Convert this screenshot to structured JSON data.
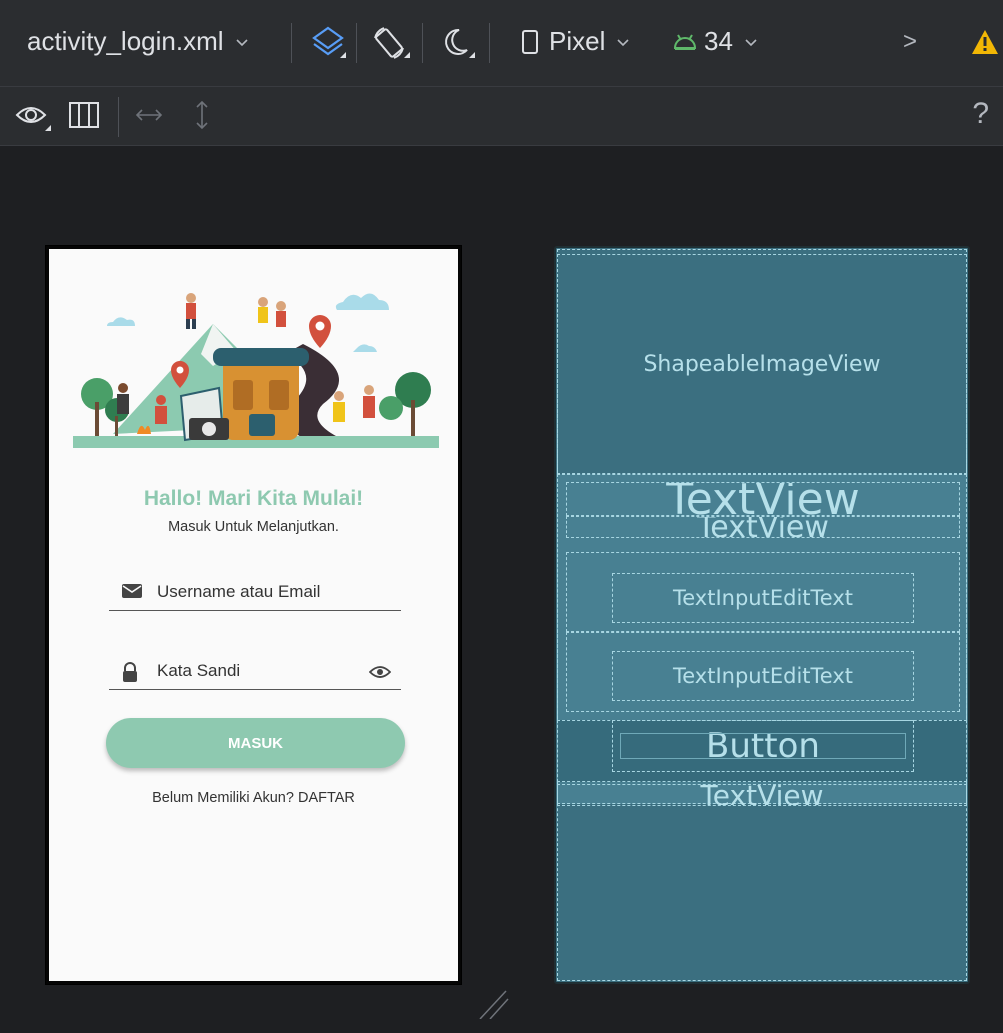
{
  "toolbar": {
    "file_name": "activity_login.xml",
    "device": "Pixel",
    "api_level": "34",
    "more": ">",
    "help": "?"
  },
  "colors": {
    "accent": "#8ec9b0",
    "blueprint": "#3b6f80",
    "blueprint_outline": "#a7d6e2",
    "warning": "#f2b705",
    "android_green": "#5fb86a",
    "toolbar_bg": "#2b2d30"
  },
  "icons": {
    "design_surface": "layers-icon",
    "orientation": "rotate-icon",
    "night_mode": "moon-icon",
    "device": "phone-icon",
    "api": "android-icon",
    "warning": "warning-icon",
    "view_options": "eye-icon",
    "split": "split-columns-icon",
    "pan_horizontal": "horizontal-arrows-icon",
    "pan_vertical": "vertical-arrows-icon"
  },
  "design": {
    "title": "Hallo! Mari Kita Mulai!",
    "subtitle": "Masuk Untuk Melanjutkan.",
    "username_hint": "Username atau Email",
    "password_hint": "Kata Sandi",
    "login_button": "MASUK",
    "register_text": "Belum Memiliki Akun? DAFTAR"
  },
  "blueprint": {
    "image_view": "ShapeableImageView",
    "title_text": "TextView",
    "subtitle_text": "TextView",
    "username_input": "TextInputEditText",
    "password_input": "TextInputEditText",
    "button": "Button",
    "register_text": "TextView"
  }
}
